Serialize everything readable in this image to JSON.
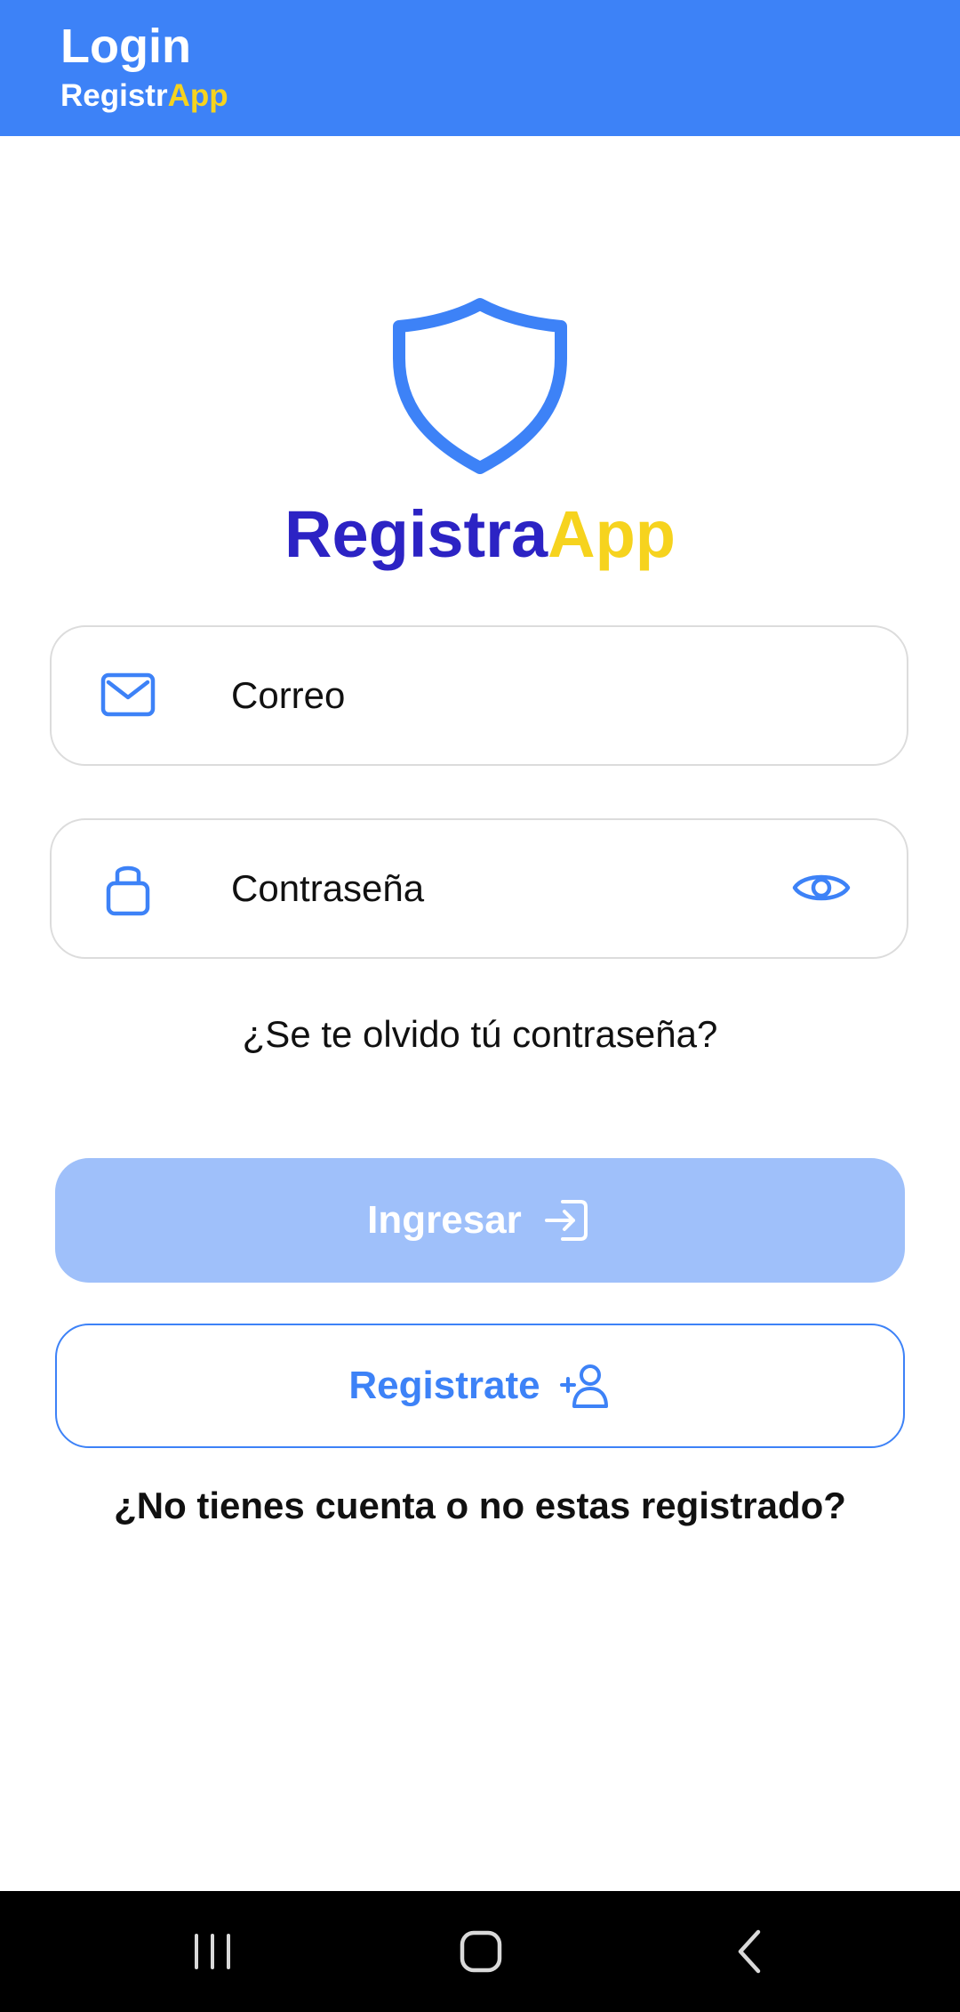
{
  "header": {
    "title": "Login",
    "subtitle_part1": "Registr",
    "subtitle_part2": "App",
    "background_color": "#3d82f7"
  },
  "logo": {
    "icon": "shield-icon",
    "brand_part1": "Registra",
    "brand_part2": "App",
    "brand_color_1": "#2c23c4",
    "brand_color_2": "#f6d31e"
  },
  "form": {
    "email": {
      "icon": "mail-icon",
      "placeholder": "Correo",
      "value": ""
    },
    "password": {
      "icon": "lock-icon",
      "placeholder": "Contraseña",
      "value": "",
      "toggle_icon": "eye-icon"
    },
    "forgot_link": "¿Se te olvido tú contraseña?"
  },
  "buttons": {
    "login_label": "Ingresar",
    "login_icon": "log-in-icon",
    "register_label": "Registrate",
    "register_icon": "person-add-icon"
  },
  "footer_text": "¿No tienes cuenta o no estas registrado?",
  "navigation_bar": {
    "recents_icon": "recents-icon",
    "home_icon": "home-icon",
    "back_icon": "back-icon"
  }
}
